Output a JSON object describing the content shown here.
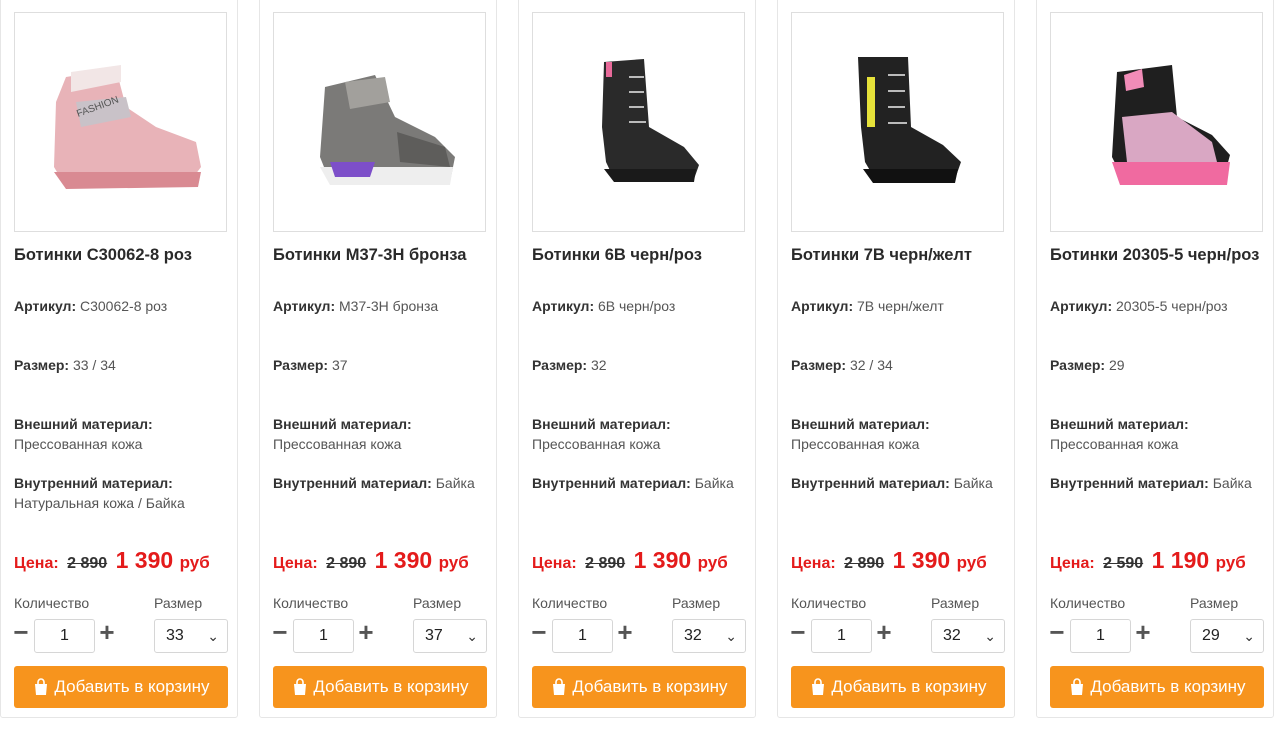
{
  "labels": {
    "article": "Артикул:",
    "size": "Размер:",
    "outer": "Внешний материал:",
    "inner": "Внутренний материал:",
    "price": "Цена:",
    "currency": "руб",
    "quantity": "Количество",
    "size_select": "Размер",
    "add_to_cart": "Добавить в корзину"
  },
  "colors": {
    "accent": "#f7941d",
    "price_red": "#e41b1b"
  },
  "products": [
    {
      "title": "Ботинки C30062-8 роз",
      "article": "C30062-8 роз",
      "size": "33 / 34",
      "outer": "Прессованная кожа",
      "inner": "Натуральная кожа / Байка",
      "old_price": "2 890",
      "new_price": "1 390",
      "quantity": "1",
      "selected_size": "33",
      "image_icon": "pink-boot-image"
    },
    {
      "title": "Ботинки M37-3H бронза",
      "article": "M37-3H бронза",
      "size": "37",
      "outer": "Прессованная кожа",
      "inner": "Байка",
      "old_price": "2 890",
      "new_price": "1 390",
      "quantity": "1",
      "selected_size": "37",
      "image_icon": "bronze-sneaker-boot-image"
    },
    {
      "title": "Ботинки 6B черн/роз",
      "article": "6B черн/роз",
      "size": "32",
      "outer": "Прессованная кожа",
      "inner": "Байка",
      "old_price": "2 890",
      "new_price": "1 390",
      "quantity": "1",
      "selected_size": "32",
      "image_icon": "black-boot-image"
    },
    {
      "title": "Ботинки 7B черн/желт",
      "article": "7B черн/желт",
      "size": "32 / 34",
      "outer": "Прессованная кожа",
      "inner": "Байка",
      "old_price": "2 890",
      "new_price": "1 390",
      "quantity": "1",
      "selected_size": "32",
      "image_icon": "black-zip-boot-image"
    },
    {
      "title": "Ботинки 20305-5 черн/роз",
      "article": "20305-5 черн/роз",
      "size": "29",
      "outer": "Прессованная кожа",
      "inner": "Байка",
      "old_price": "2 590",
      "new_price": "1 190",
      "quantity": "1",
      "selected_size": "29",
      "image_icon": "black-pink-boot-image"
    }
  ]
}
